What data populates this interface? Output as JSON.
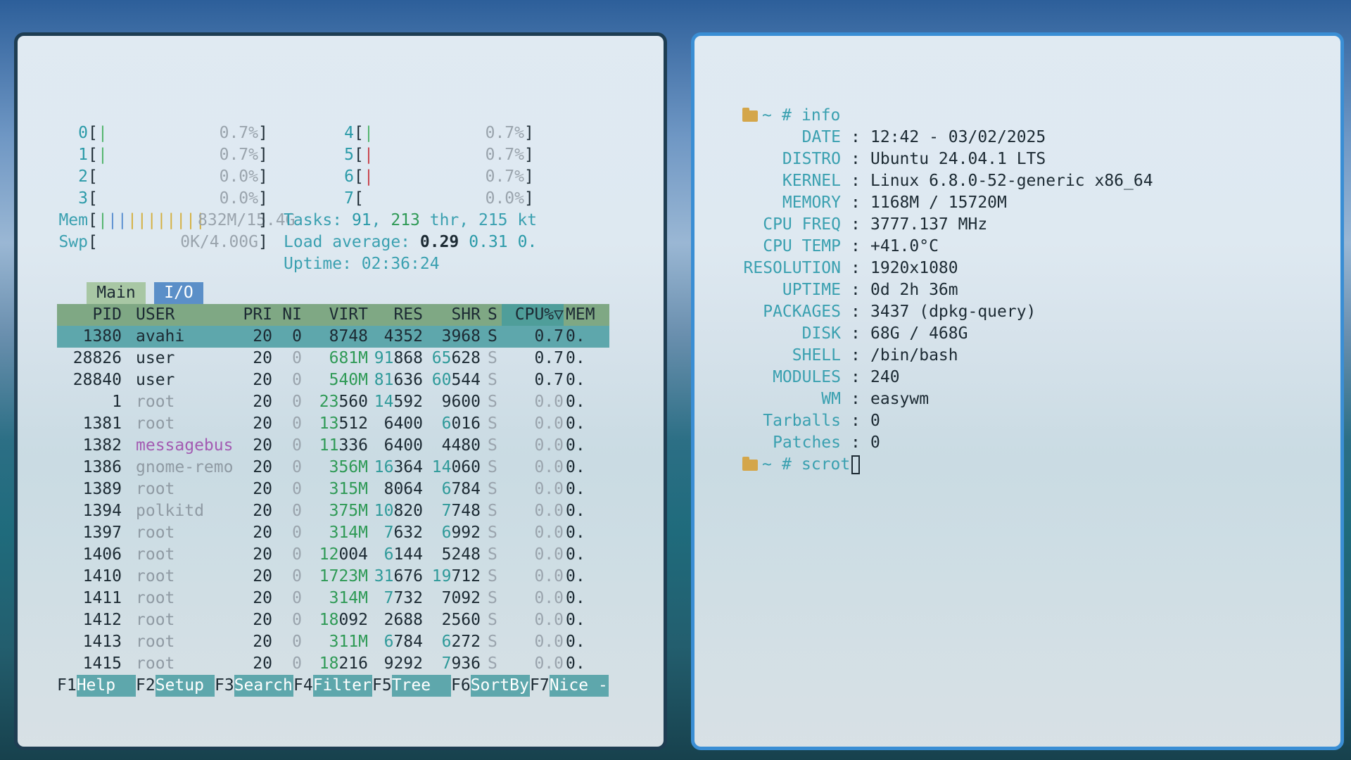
{
  "htop": {
    "cpus": [
      {
        "id": "0",
        "bar": "|",
        "bar_color": "cyan",
        "pct": "0.7%"
      },
      {
        "id": "1",
        "bar": "|",
        "bar_color": "cyan",
        "pct": "0.7%"
      },
      {
        "id": "2",
        "bar": "",
        "bar_color": "cyan",
        "pct": "0.0%"
      },
      {
        "id": "3",
        "bar": "",
        "bar_color": "cyan",
        "pct": "0.0%"
      },
      {
        "id": "4",
        "bar": "|",
        "bar_color": "cyan",
        "pct": "0.7%"
      },
      {
        "id": "5",
        "bar": "|",
        "bar_color": "red",
        "pct": "0.7%"
      },
      {
        "id": "6",
        "bar": "|",
        "bar_color": "red",
        "pct": "0.7%"
      },
      {
        "id": "7",
        "bar": "",
        "bar_color": "cyan",
        "pct": "0.0%"
      }
    ],
    "mem": {
      "label": "Mem",
      "bar_green": "|",
      "bar_blue": "||",
      "bar_yellow": "||||||||",
      "value": "832M/15.4G"
    },
    "swp": {
      "label": "Swp",
      "value": "0K/4.00G"
    },
    "tasks": {
      "label": "Tasks: ",
      "procs": "91",
      "sep1": ", ",
      "threads": "213",
      "thr_label": " thr, ",
      "kthreads": "215",
      "kt_label": " kt"
    },
    "load": {
      "label": "Load average: ",
      "l1": "0.29",
      "l5": "0.31",
      "l15": "0."
    },
    "uptime": {
      "label": "Uptime: ",
      "value": "02:36:24"
    },
    "tabs": {
      "main": "Main",
      "io": "I/O"
    },
    "headers": {
      "pid": "PID",
      "user": "USER",
      "pri": "PRI",
      "ni": "NI",
      "virt": "VIRT",
      "res": "RES",
      "shr": "SHR",
      "s": "S",
      "cpu": "CPU%▽",
      "mem": "MEM"
    },
    "processes": [
      {
        "pid": "1380",
        "user": "avahi",
        "pri": "20",
        "ni": "0",
        "virt": "8748",
        "res": "4352",
        "shr": "3968",
        "s": "S",
        "cpu": "0.7",
        "mem": "0.",
        "selected": true
      },
      {
        "pid": "28826",
        "user": "user",
        "pri": "20",
        "ni": "0",
        "virt_hi": "681M",
        "virt_lo": "",
        "res_hi": "91",
        "res_lo": "868",
        "shr_hi": "65",
        "shr_lo": "628",
        "s": "S",
        "cpu": "0.7",
        "mem": "0."
      },
      {
        "pid": "28840",
        "user": "user",
        "pri": "20",
        "ni": "0",
        "virt_hi": "540M",
        "virt_lo": "",
        "res_hi": "81",
        "res_lo": "636",
        "shr_hi": "60",
        "shr_lo": "544",
        "s": "S",
        "cpu": "0.7",
        "mem": "0."
      },
      {
        "pid": "1",
        "user": "root",
        "pri": "20",
        "ni": "0",
        "virt_hi": "23",
        "virt_lo": "560",
        "res_hi": "14",
        "res_lo": "592",
        "shr_hi": "",
        "shr_lo": "9600",
        "s": "S",
        "cpu": "0.0",
        "mem": "0."
      },
      {
        "pid": "1381",
        "user": "root",
        "pri": "20",
        "ni": "0",
        "virt_hi": "13",
        "virt_lo": "512",
        "res_hi": "",
        "res_lo": "6400",
        "shr_hi": "6",
        "shr_lo": "016",
        "s": "S",
        "cpu": "0.0",
        "mem": "0."
      },
      {
        "pid": "1382",
        "user": "messagebus",
        "pri": "20",
        "ni": "0",
        "virt_hi": "11",
        "virt_lo": "336",
        "res_hi": "",
        "res_lo": "6400",
        "shr_hi": "",
        "shr_lo": "4480",
        "s": "S",
        "cpu": "0.0",
        "mem": "0."
      },
      {
        "pid": "1386",
        "user": "gnome-remo",
        "pri": "20",
        "ni": "0",
        "virt_hi": "356M",
        "virt_lo": "",
        "res_hi": "16",
        "res_lo": "364",
        "shr_hi": "14",
        "shr_lo": "060",
        "s": "S",
        "cpu": "0.0",
        "mem": "0."
      },
      {
        "pid": "1389",
        "user": "root",
        "pri": "20",
        "ni": "0",
        "virt_hi": "315M",
        "virt_lo": "",
        "res_hi": "",
        "res_lo": "8064",
        "shr_hi": "6",
        "shr_lo": "784",
        "s": "S",
        "cpu": "0.0",
        "mem": "0."
      },
      {
        "pid": "1394",
        "user": "polkitd",
        "pri": "20",
        "ni": "0",
        "virt_hi": "375M",
        "virt_lo": "",
        "res_hi": "10",
        "res_lo": "820",
        "shr_hi": "7",
        "shr_lo": "748",
        "s": "S",
        "cpu": "0.0",
        "mem": "0."
      },
      {
        "pid": "1397",
        "user": "root",
        "pri": "20",
        "ni": "0",
        "virt_hi": "314M",
        "virt_lo": "",
        "res_hi": "7",
        "res_lo": "632",
        "shr_hi": "6",
        "shr_lo": "992",
        "s": "S",
        "cpu": "0.0",
        "mem": "0."
      },
      {
        "pid": "1406",
        "user": "root",
        "pri": "20",
        "ni": "0",
        "virt_hi": "12",
        "virt_lo": "004",
        "res_hi": "6",
        "res_lo": "144",
        "shr_hi": "",
        "shr_lo": "5248",
        "s": "S",
        "cpu": "0.0",
        "mem": "0."
      },
      {
        "pid": "1410",
        "user": "root",
        "pri": "20",
        "ni": "0",
        "virt_hi": "1723M",
        "virt_lo": "",
        "res_hi": "31",
        "res_lo": "676",
        "shr_hi": "19",
        "shr_lo": "712",
        "s": "S",
        "cpu": "0.0",
        "mem": "0."
      },
      {
        "pid": "1411",
        "user": "root",
        "pri": "20",
        "ni": "0",
        "virt_hi": "314M",
        "virt_lo": "",
        "res_hi": "7",
        "res_lo": "732",
        "shr_hi": "",
        "shr_lo": "7092",
        "s": "S",
        "cpu": "0.0",
        "mem": "0."
      },
      {
        "pid": "1412",
        "user": "root",
        "pri": "20",
        "ni": "0",
        "virt_hi": "18",
        "virt_lo": "092",
        "res_hi": "",
        "res_lo": "2688",
        "shr_hi": "",
        "shr_lo": "2560",
        "s": "S",
        "cpu": "0.0",
        "mem": "0."
      },
      {
        "pid": "1413",
        "user": "root",
        "pri": "20",
        "ni": "0",
        "virt_hi": "311M",
        "virt_lo": "",
        "res_hi": "6",
        "res_lo": "784",
        "shr_hi": "6",
        "shr_lo": "272",
        "s": "S",
        "cpu": "0.0",
        "mem": "0."
      },
      {
        "pid": "1415",
        "user": "root",
        "pri": "20",
        "ni": "0",
        "virt_hi": "18",
        "virt_lo": "216",
        "res_hi": "",
        "res_lo": "9292",
        "shr_hi": "7",
        "shr_lo": "936",
        "s": "S",
        "cpu": "0.0",
        "mem": "0."
      }
    ],
    "fkeys": [
      {
        "key": "F1",
        "label": "Help  "
      },
      {
        "key": "F2",
        "label": "Setup "
      },
      {
        "key": "F3",
        "label": "Search"
      },
      {
        "key": "F4",
        "label": "Filter"
      },
      {
        "key": "F5",
        "label": "Tree  "
      },
      {
        "key": "F6",
        "label": "SortBy"
      },
      {
        "key": "F7",
        "label": "Nice -"
      }
    ]
  },
  "terminal": {
    "prompt1": {
      "path": "~",
      "hash": "#",
      "cmd": "info"
    },
    "info": [
      {
        "label": "DATE",
        "value": "12:42 - 03/02/2025"
      },
      {
        "label": "DISTRO",
        "value": "Ubuntu 24.04.1 LTS"
      },
      {
        "label": "KERNEL",
        "value": "Linux 6.8.0-52-generic x86_64"
      },
      {
        "label": "MEMORY",
        "value": "1168M / 15720M"
      },
      {
        "label": "CPU FREQ",
        "value": "3777.137 MHz"
      },
      {
        "label": "CPU TEMP",
        "value": "+41.0°C"
      },
      {
        "label": "RESOLUTION",
        "value": "1920x1080"
      },
      {
        "label": "UPTIME",
        "value": "0d 2h 36m"
      },
      {
        "label": "PACKAGES",
        "value": "3437 (dpkg-query)"
      },
      {
        "label": "DISK",
        "value": "68G / 468G"
      },
      {
        "label": "SHELL",
        "value": "/bin/bash"
      },
      {
        "label": "MODULES",
        "value": "240"
      },
      {
        "label": "WM",
        "value": "easywm"
      },
      {
        "label": "Tarballs",
        "value": "0"
      },
      {
        "label": "Patches",
        "value": "0"
      }
    ],
    "sep": ":",
    "prompt2": {
      "path": "~",
      "hash": "#",
      "cmd": "scrot"
    }
  },
  "colors": {
    "accent_teal": "#5ea7ac",
    "header_green": "#7fa884",
    "io_tab": "#5b8fc8",
    "folder": "#d4a64a",
    "right_border": "#3a8ed4"
  }
}
